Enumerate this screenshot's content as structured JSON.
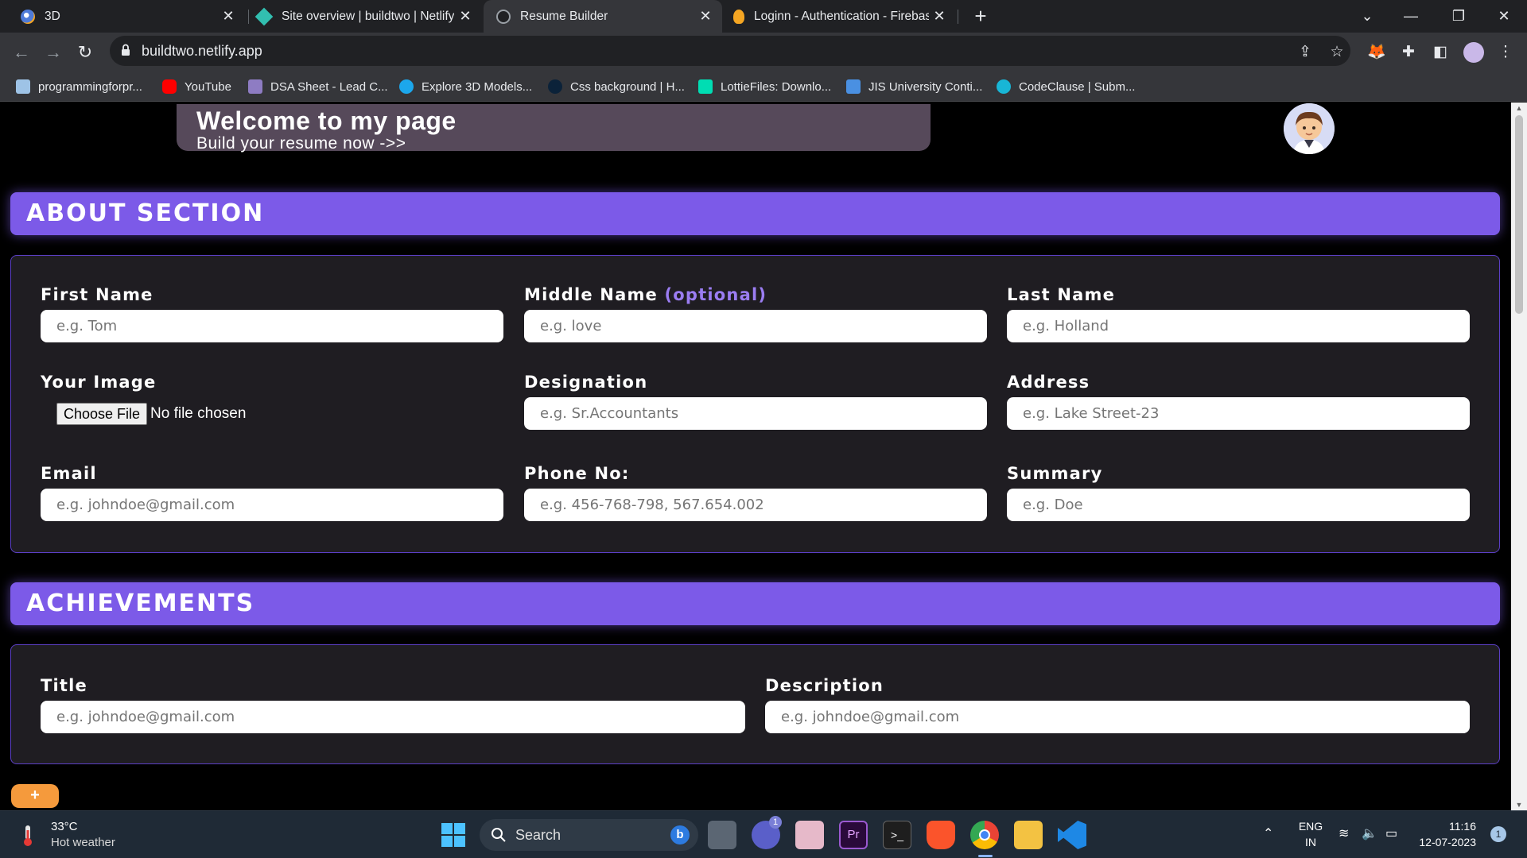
{
  "browser": {
    "tabs": [
      {
        "title": "3D",
        "favicon_color": "#4f7bd8"
      },
      {
        "title": "Site overview | buildtwo | Netlify",
        "favicon_color": "#32bfb0"
      },
      {
        "title": "Resume Builder",
        "favicon_color": "#9aa0a6"
      },
      {
        "title": "Loginn - Authentication - Firebas",
        "favicon_color": "#f5a623"
      }
    ],
    "new_tab": "+",
    "url": "buildtwo.netlify.app",
    "bookmarks": [
      {
        "label": "programmingforpr...",
        "color": "#9ec3e6"
      },
      {
        "label": "YouTube",
        "color": "#ff0000"
      },
      {
        "label": "DSA Sheet - Lead C...",
        "color": "#8e7cc3"
      },
      {
        "label": "Explore 3D Models...",
        "color": "#1ca7ec"
      },
      {
        "label": "Css background | H...",
        "color": "#0b2239"
      },
      {
        "label": "LottieFiles: Downlo...",
        "color": "#00ddb3"
      },
      {
        "label": "JIS University Conti...",
        "color": "#4a90e2"
      },
      {
        "label": "CodeClause | Subm...",
        "color": "#18b6d6"
      }
    ]
  },
  "header": {
    "title": "Welcome to my page",
    "subtitle": "Build your resume now ->>"
  },
  "about": {
    "heading": "ABOUT SECTION",
    "first_name": {
      "label": "First Name",
      "placeholder": "e.g. Tom"
    },
    "middle_name": {
      "label": "Middle Name",
      "optional": "(optional)",
      "placeholder": "e.g. love"
    },
    "last_name": {
      "label": "Last Name",
      "placeholder": "e.g. Holland"
    },
    "image": {
      "label": "Your Image",
      "button": "Choose File",
      "status": "No file chosen"
    },
    "designation": {
      "label": "Designation",
      "placeholder": "e.g. Sr.Accountants"
    },
    "address": {
      "label": "Address",
      "placeholder": "e.g. Lake Street-23"
    },
    "email": {
      "label": "Email",
      "placeholder": "e.g. johndoe@gmail.com"
    },
    "phone": {
      "label": "Phone No:",
      "placeholder": "e.g. 456-768-798, 567.654.002"
    },
    "summary": {
      "label": "Summary",
      "placeholder": "e.g. Doe"
    }
  },
  "achievements": {
    "heading": "ACHIEVEMENTS",
    "title": {
      "label": "Title",
      "placeholder": "e.g. johndoe@gmail.com"
    },
    "description": {
      "label": "Description",
      "placeholder": "e.g. johndoe@gmail.com"
    },
    "add_button": "+"
  },
  "taskbar": {
    "weather_temp": "33°C",
    "weather_desc": "Hot weather",
    "search_label": "Search",
    "lang_1": "ENG",
    "lang_2": "IN",
    "time": "11:16",
    "date": "12-07-2023",
    "notification_count": "1",
    "teams_badge": "1"
  },
  "colors": {
    "accent": "#7c5ae8",
    "optional_text": "#9b7df2",
    "add_button": "#f59a3c"
  }
}
